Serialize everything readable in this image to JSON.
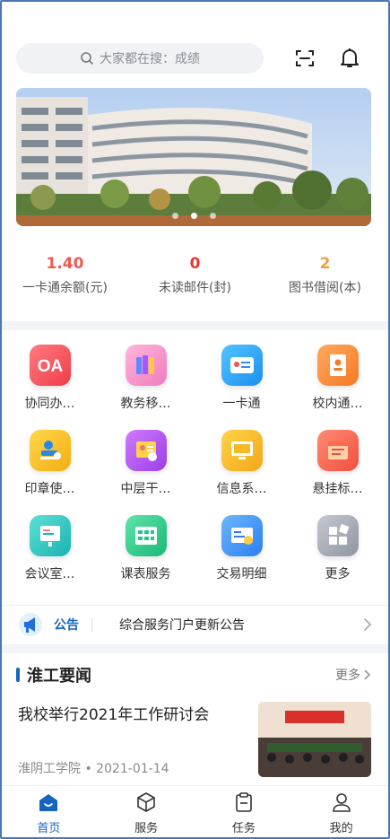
{
  "search": {
    "placeholder": "大家都在搜：成绩"
  },
  "header": {
    "scan_icon": "scan-icon",
    "bell_icon": "bell-icon"
  },
  "banner": {
    "dot_count": 3,
    "active_dot": 1
  },
  "stats": [
    {
      "value": "1.40",
      "label": "一卡通余额(元)",
      "color": "#ee5a52"
    },
    {
      "value": "0",
      "label": "未读邮件(封)",
      "color": "#e53935"
    },
    {
      "value": "2",
      "label": "图书借阅(本)",
      "color": "#f0a044"
    }
  ],
  "apps": [
    {
      "label": "协同办…",
      "icon": "oa-icon",
      "color": "#f2545b"
    },
    {
      "label": "教务移…",
      "icon": "books-icon",
      "color": "#f59bcf"
    },
    {
      "label": "一卡通",
      "icon": "card-icon",
      "color": "#2aa6f2"
    },
    {
      "label": "校内通…",
      "icon": "contacts-icon",
      "color": "#f5903a"
    },
    {
      "label": "印章使…",
      "icon": "stamp-icon",
      "color": "#f7c12b"
    },
    {
      "label": "中层干…",
      "icon": "cadre-icon",
      "color": "#b14ef2"
    },
    {
      "label": "信息系…",
      "icon": "computer-icon",
      "color": "#f6bb24"
    },
    {
      "label": "悬挂标…",
      "icon": "banner-icon",
      "color": "#f86b5a"
    },
    {
      "label": "会议室…",
      "icon": "meeting-icon",
      "color": "#30c7c2"
    },
    {
      "label": "课表服务",
      "icon": "timetable-icon",
      "color": "#28c689"
    },
    {
      "label": "交易明细",
      "icon": "transaction-icon",
      "color": "#3a8df4"
    },
    {
      "label": "更多",
      "icon": "more-icon",
      "color": "#9ea3ad"
    }
  ],
  "notice": {
    "tag": "公告",
    "text": "综合服务门户更新公告"
  },
  "news": {
    "section_title": "淮工要闻",
    "more_label": "更多",
    "items": [
      {
        "headline": "我校举行2021年工作研讨会",
        "source": "淮阴工学院",
        "date": "2021-01-14",
        "meta": "淮阴工学院 • 2021-01-14"
      }
    ]
  },
  "tabs": [
    {
      "label": "首页",
      "icon": "home-icon",
      "active": true
    },
    {
      "label": "服务",
      "icon": "cube-icon",
      "active": false
    },
    {
      "label": "任务",
      "icon": "clipboard-icon",
      "active": false
    },
    {
      "label": "我的",
      "icon": "user-icon",
      "active": false
    }
  ],
  "colors": {
    "accent": "#1565c0",
    "band": "#f3f4f7"
  }
}
